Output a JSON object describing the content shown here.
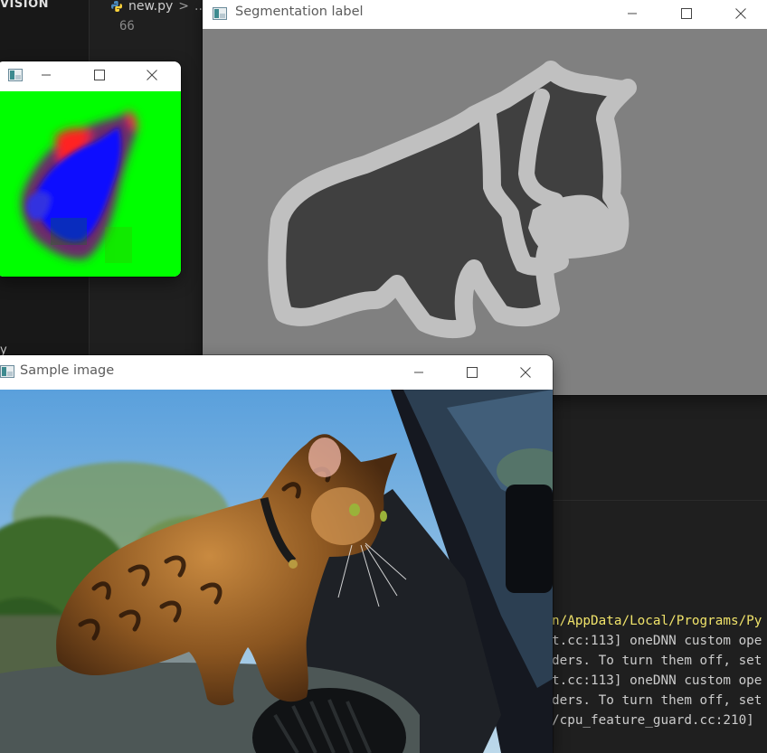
{
  "vscode": {
    "sidebar_header": "VISION",
    "sidebar_letter": "y",
    "tab": {
      "filename": "new.py",
      "crumb_separator": ">",
      "crumb_more": ".."
    },
    "line_number": "66",
    "terminal_lines": [
      {
        "text": "n/AppData/Local/Programs/Py",
        "kind": "path"
      },
      {
        "text": "t.cc:113] oneDNN custom ope",
        "kind": "log"
      },
      {
        "text": "ders. To turn them off, set",
        "kind": "log"
      },
      {
        "text": "t.cc:113] oneDNN custom ope",
        "kind": "log"
      },
      {
        "text": "ders. To turn them off, set",
        "kind": "log"
      },
      {
        "text": "/cpu_feature_guard.cc:210]",
        "kind": "log"
      }
    ]
  },
  "windows": {
    "segmentation": {
      "title": "Segmentation label",
      "icon": "app-window-icon"
    },
    "prediction": {
      "title": "",
      "icon": "app-window-icon"
    },
    "sample": {
      "title": "Sample image",
      "icon": "app-window-icon"
    }
  },
  "window_controls": [
    "minimize-icon",
    "maximize-icon",
    "close-icon"
  ],
  "colors": {
    "mask_background": "#808080",
    "mask_pet": "#404040",
    "mask_border": "#c0c0c0",
    "prediction_background": "#00ff00",
    "prediction_red": "#ff2020",
    "prediction_blue": "#1010ff",
    "terminal_path": "#f0e36a"
  }
}
